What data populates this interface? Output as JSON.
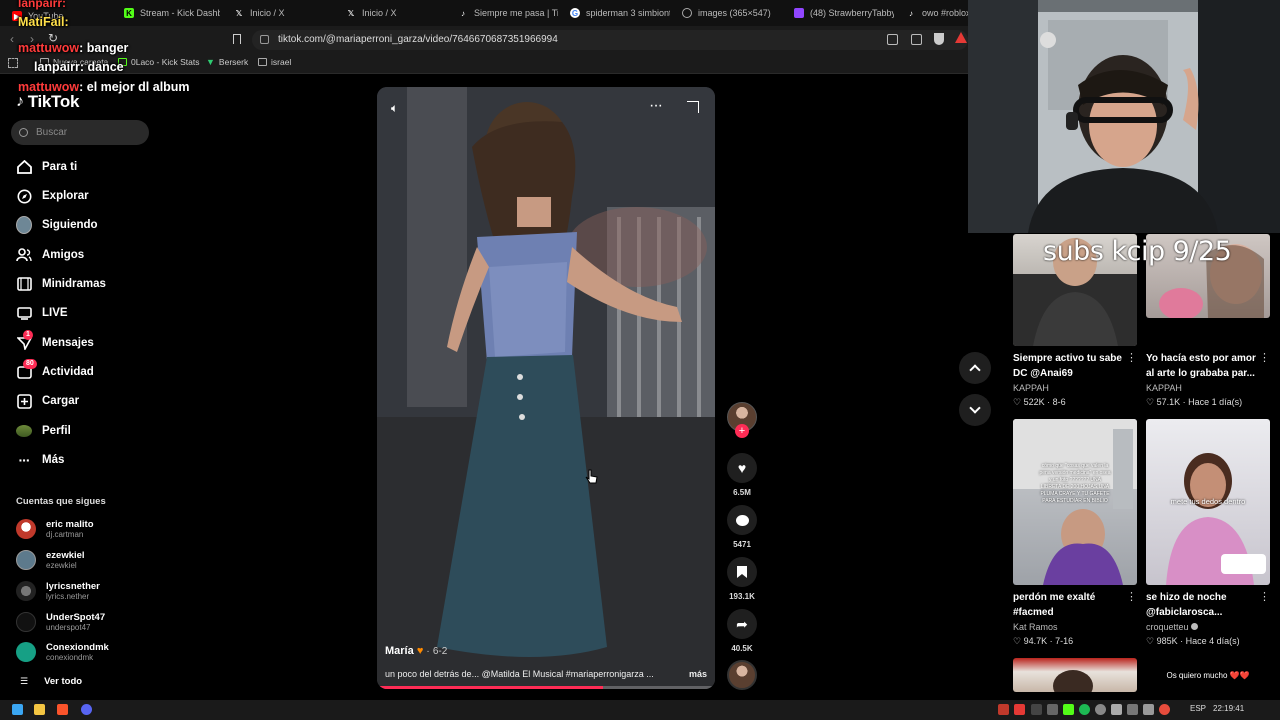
{
  "browser": {
    "tabs": [
      {
        "label": "YouTube",
        "icon": "youtube-icon"
      },
      {
        "label": "Stream - Kick Dashbo",
        "icon": "kick-icon"
      },
      {
        "label": "Inicio / X",
        "icon": "x-icon"
      },
      {
        "label": "Inicio / X",
        "icon": "x-icon"
      },
      {
        "label": "Siempre me pasa | Tik",
        "icon": "tiktok-icon"
      },
      {
        "label": "spiderman 3 simbiont",
        "icon": "google-icon"
      },
      {
        "label": "images (365×547)",
        "icon": "globe-icon"
      },
      {
        "label": "(48) StrawberryTabby",
        "icon": "twitch-icon"
      },
      {
        "label": "owo #roblox",
        "icon": "tiktok-icon"
      }
    ],
    "url": "tiktok.com/@mariaperroni_garza/video/7646670687351966994",
    "bookmarks": [
      "Nueva carpeta",
      "0Laco - Kick Stats",
      "Berserk",
      "israel"
    ]
  },
  "chat": [
    {
      "user": "lanpairr:",
      "text": ""
    },
    {
      "user": "MatiFail:",
      "text": ""
    },
    {
      "user": "mattuwow",
      "text": ": banger"
    },
    {
      "user": "lanpairr",
      "text": ": dance"
    },
    {
      "user": "mattuwow",
      "text": ": el mejor dl album"
    }
  ],
  "sidebar": {
    "logo": "TikTok",
    "search_placeholder": "Buscar",
    "nav": [
      {
        "label": "Para ti",
        "icon": "home-icon"
      },
      {
        "label": "Explorar",
        "icon": "compass-icon"
      },
      {
        "label": "Siguiendo",
        "icon": "following-avatar"
      },
      {
        "label": "Amigos",
        "icon": "friends-icon"
      },
      {
        "label": "Minidramas",
        "icon": "film-icon"
      },
      {
        "label": "LIVE",
        "icon": "live-icon"
      },
      {
        "label": "Mensajes",
        "icon": "messages-icon",
        "badge": "1"
      },
      {
        "label": "Actividad",
        "icon": "activity-icon",
        "badge": "80"
      },
      {
        "label": "Cargar",
        "icon": "upload-icon"
      },
      {
        "label": "Perfil",
        "icon": "profile-avatar"
      },
      {
        "label": "Más",
        "icon": "more-icon"
      }
    ],
    "following_title": "Cuentas que sigues",
    "following": [
      {
        "name": "eric malito",
        "handle": "dj.cartman",
        "color": "#c0392b"
      },
      {
        "name": "ezewkiel",
        "handle": "ezewkiel",
        "color": "#5d7a8c"
      },
      {
        "name": "lyricsnether",
        "handle": "lyrics.nether",
        "color": "#444"
      },
      {
        "name": "UnderSpot47",
        "handle": "underspot47",
        "color": "#111"
      },
      {
        "name": "Conexiondmk",
        "handle": "conexiondmk",
        "color": "#16a085"
      }
    ],
    "see_all": "Ver todo"
  },
  "video": {
    "author": "María",
    "date": "6-2",
    "caption": "un poco del detrás de... @Matilda El Musical #mariaperronigarza ...",
    "more": "más",
    "progress": 0.67,
    "likes": "6.5M",
    "comments": "5471",
    "saves": "193.1K",
    "shares": "40.5K"
  },
  "overlay_text": "subs kcip 9/25",
  "recommendations": [
    {
      "title": "Siempre activo tu sabe DC @Anai69",
      "author": "KAPPAH",
      "likes": "522K",
      "date": "8-6"
    },
    {
      "title": "Yo hacía esto por amor al arte lo grababa par...",
      "author": "KAPPAH",
      "likes": "57.1K",
      "date": "Hace 1 día(s)"
    },
    {
      "title": "perdón me exalté #facmed",
      "author": "Kat Ramos",
      "likes": "94.7K",
      "date": "7-16",
      "thumb_text": "cómo que \"cosas que valen la pena versión medicina\" en osea y un foto ??????? UNA LIBRETA DE 200 HOJAS,UNA PLUMA CRAYE Y TU GAFETE PARA ESTUDIAR EN BIBLIO"
    },
    {
      "title": "se hizo de noche @fabiclarosca...",
      "author": "croquetteu",
      "likes": "985K",
      "date": "Hace 4 día(s)",
      "thumb_text": "mete tus dedos dentro"
    }
  ],
  "bottom_thumb_text": "Os quiero mucho ❤️❤️",
  "taskbar": {
    "lang": "ESP",
    "time": "22:19:41"
  }
}
